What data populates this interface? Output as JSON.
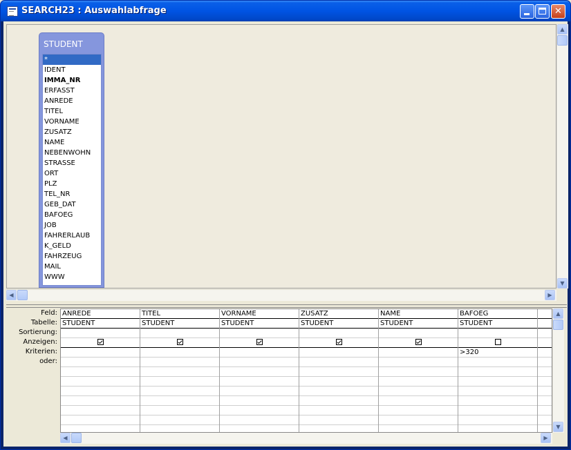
{
  "window": {
    "title": "SEARCH23 : Auswahlabfrage"
  },
  "table": {
    "name": "STUDENT",
    "fields": [
      "*",
      "IDENT",
      "IMMA_NR",
      "ERFASST",
      "ANREDE",
      "TITEL",
      "VORNAME",
      "ZUSATZ",
      "NAME",
      "NEBENWOHN",
      "STRASSE",
      "ORT",
      "PLZ",
      "TEL_NR",
      "GEB_DAT",
      "BAFOEG",
      "JOB",
      "FAHRERLAUB",
      "K_GELD",
      "FAHRZEUG",
      "MAIL",
      "WWW"
    ],
    "selected_field": "*",
    "key_field": "IMMA_NR"
  },
  "grid": {
    "row_labels": [
      "Feld:",
      "Tabelle:",
      "Sortierung:",
      "Anzeigen:",
      "Kriterien:",
      "oder:"
    ],
    "columns": [
      {
        "field": "ANREDE",
        "table": "STUDENT",
        "sort": "",
        "show": true,
        "criteria": ""
      },
      {
        "field": "TITEL",
        "table": "STUDENT",
        "sort": "",
        "show": true,
        "criteria": ""
      },
      {
        "field": "VORNAME",
        "table": "STUDENT",
        "sort": "",
        "show": true,
        "criteria": ""
      },
      {
        "field": "ZUSATZ",
        "table": "STUDENT",
        "sort": "",
        "show": true,
        "criteria": ""
      },
      {
        "field": "NAME",
        "table": "STUDENT",
        "sort": "",
        "show": true,
        "criteria": ""
      },
      {
        "field": "BAFOEG",
        "table": "STUDENT",
        "sort": "",
        "show": false,
        "criteria": ">320"
      }
    ]
  },
  "colors": {
    "titlebar": "#0054E3",
    "table_header": "#8596DD",
    "selection": "#316AC5"
  }
}
